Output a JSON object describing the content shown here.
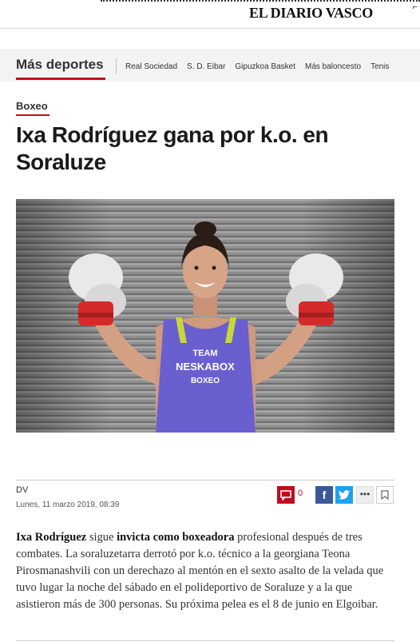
{
  "header": {
    "logo": "EL DIARIO VASCO",
    "corner_mark": "⌐"
  },
  "nav": {
    "title": "Más deportes",
    "links": [
      "Real Sociedad",
      "S. D. Eibar",
      "Gipuzkoa Basket",
      "Más baloncesto",
      "Tenis"
    ]
  },
  "article": {
    "section": "Boxeo",
    "headline": "Ixa Rodríguez gana por k.o. en Soraluze",
    "image": {
      "shirt_line1": "TEAM",
      "shirt_line2": "NESKABOX",
      "shirt_line3": "BOXEO"
    },
    "author": "DV",
    "date": "Lunes, 11 marzo 2019, 08:39",
    "comments_count": "0",
    "body": {
      "part1": "Ixa Rodríguez",
      "part2": " sigue ",
      "part3": "invicta como boxeadora",
      "part4": " profesional después de tres combates. La soraluzetarra derrotó por k.o. técnico a la georgiana Teona Pirosmanashvili con un derechazo al mentón en el sexto asalto de la velada que tuvo lugar la noche del sábado en el polideportivo de Soraluze y a la que asistieron más de 300 personas. Su próxima pelea es el 8 de junio en Elgoibar."
    }
  },
  "colors": {
    "accent": "#c00d1e",
    "facebook": "#3b5998",
    "twitter": "#1da1f2"
  }
}
